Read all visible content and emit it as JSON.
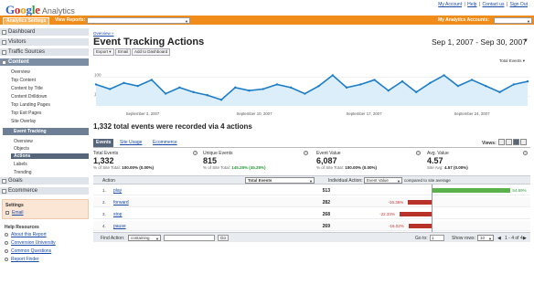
{
  "header": {
    "logo_google": [
      "G",
      "o",
      "o",
      "g",
      "l",
      "e"
    ],
    "logo_product": "Analytics",
    "top_links": [
      "My Account",
      "Help",
      "Contact us",
      "Sign Out"
    ],
    "settings_label": "Analytics Settings",
    "view_reports_label": "View Reports:",
    "accounts_label": "My Analytics Accounts:"
  },
  "sidebar": {
    "sections": [
      "Dashboard",
      "Visitors",
      "Traffic Sources",
      "Content"
    ],
    "content_items": [
      "Overview",
      "Top Content",
      "Content by Title",
      "Content Drilldown",
      "Top Landing Pages",
      "Top Exit Pages",
      "Site Overlay"
    ],
    "event_tracking": "Event Tracking",
    "event_items": [
      "Overview",
      "Objects",
      "Actions",
      "Labels",
      "Trending"
    ],
    "goals": "Goals",
    "ecommerce": "Ecommerce",
    "settings_title": "Settings",
    "settings_email": "Email",
    "help_title": "Help Resources",
    "help_links": [
      "About this Report",
      "Conversion University",
      "Common Questions",
      "Report Finder"
    ]
  },
  "main": {
    "breadcrumb": "Overview »",
    "title": "Event Tracking Actions",
    "date_range": "Sep 1, 2007 - Sep 30, 2007",
    "toolbar": [
      "Export ▾",
      "Email",
      "Add to Dashboard"
    ],
    "metric_select": "Total Events ▾",
    "summary": "1,332 total events were recorded via 4 actions",
    "tabs": [
      "Events",
      "Site Usage",
      "Ecommerce"
    ],
    "views_label": "Views:",
    "metrics": [
      {
        "label": "Total Events",
        "value": "1,332",
        "sub_prefix": "% of Site Total: ",
        "sub_value": "100.00% (0.00%)"
      },
      {
        "label": "Unique Events",
        "value": "815",
        "sub_prefix": "% of Site Total: ",
        "sub_value": "145.28% (45.28%)"
      },
      {
        "label": "Event Value",
        "value": "6,087",
        "sub_prefix": "% of Site Total: ",
        "sub_value": "100.00% (0.00%)"
      },
      {
        "label": "Avg. Value",
        "value": "4.57",
        "sub_prefix": "Site Avg: ",
        "sub_value": "4.57 (0.00%)"
      }
    ],
    "table": {
      "col_action": "Action",
      "col_metric": "Total Events",
      "col_individual": "Individual Action:",
      "col_compare_metric": "Event Value",
      "col_compare_text": "compared to site average",
      "rows": [
        {
          "num": "1.",
          "name": "play",
          "value": "513",
          "pct": "54.69%",
          "pct_value": 54.69
        },
        {
          "num": "2.",
          "name": "forward",
          "value": "282",
          "pct": "-16.35%",
          "pct_value": -16.35
        },
        {
          "num": "3.",
          "name": "stop",
          "value": "268",
          "pct": "-22.33%",
          "pct_value": -22.33
        },
        {
          "num": "4.",
          "name": "pause",
          "value": "269",
          "pct": "-16.02%",
          "pct_value": -16.02
        }
      ]
    },
    "footer": {
      "find_action": "Find Action:",
      "find_mode": "containing",
      "go": "Go",
      "goto": "Go to:",
      "goto_value": "1",
      "show_rows": "Show rows:",
      "rows_value": "10",
      "pagination": "1 - 4 of 4"
    }
  },
  "chart_data": {
    "type": "line",
    "series": [
      {
        "name": "Total Events",
        "values": [
          44,
          41,
          45,
          43,
          47,
          38,
          42,
          39,
          37,
          34,
          42,
          40,
          41,
          44,
          42,
          38,
          43,
          50,
          42,
          44,
          47,
          40,
          46,
          39,
          45,
          50,
          43,
          47,
          43,
          39,
          44,
          46
        ]
      }
    ],
    "x_ticks": [
      "September 3, 2007",
      "September 10, 2007",
      "September 17, 2007",
      "September 24, 2007"
    ],
    "y_ticks": [
      "100",
      "100"
    ],
    "accent": "#1c7dc7"
  },
  "colors": {
    "orange": "#ef8c1a",
    "positive": "#5bb24a",
    "negative": "#b8322a",
    "accent": "#1a4aa8"
  }
}
